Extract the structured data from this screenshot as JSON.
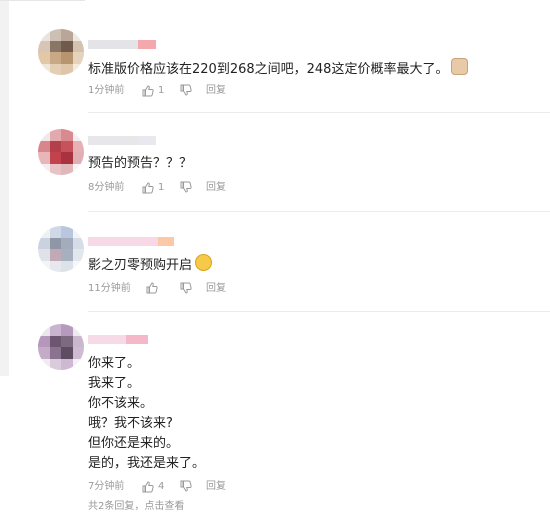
{
  "comments": [
    {
      "text_lines": [
        "标准版价格应该在220到268之间吧，248这定价概率最大了。"
      ],
      "time": "1分钟前",
      "likes": "1",
      "reply": "回复"
    },
    {
      "text_lines": [
        "预告的预告？？？"
      ],
      "time": "8分钟前",
      "likes": "1",
      "reply": "回复"
    },
    {
      "text_lines": [
        "影之刃零预购开启"
      ],
      "time": "11分钟前",
      "likes": "",
      "reply": "回复"
    },
    {
      "text_lines": [
        "你来了。",
        "我来了。",
        "你不该来。",
        "哦？我不该来?",
        "但你还是来的。",
        "是的，我还是来了。"
      ],
      "time": "7分钟前",
      "likes": "4",
      "reply": "回复"
    }
  ],
  "footer": {
    "reply_summary": "共2条回复，点击查看"
  },
  "icons": [
    "thumbs-up-icon",
    "thumbs-down-icon",
    "emoji-face-icon"
  ],
  "colors": {
    "text": "#222222",
    "meta": "#999999",
    "divider": "#ececec"
  }
}
